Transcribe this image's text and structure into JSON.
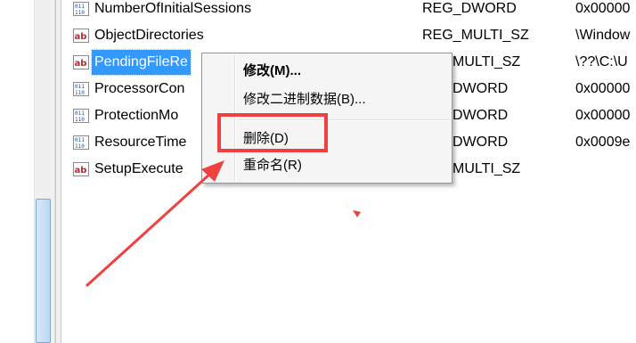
{
  "values": [
    {
      "name": "NumberOfInitialSessions",
      "type": "REG_DWORD",
      "data": "0x00000",
      "icon": "dword-icon"
    },
    {
      "name": "ObjectDirectories",
      "type": "REG_MULTI_SZ",
      "data": "\\Window",
      "icon": "string-icon"
    },
    {
      "name": "PendingFileRe",
      "type": "MULTI_SZ",
      "data": "\\??\\C:\\U",
      "icon": "string-icon",
      "selected": true
    },
    {
      "name": "ProcessorCon",
      "type": "DWORD",
      "data": "0x00000",
      "icon": "dword-icon"
    },
    {
      "name": "ProtectionMo",
      "type": "DWORD",
      "data": "0x00000",
      "icon": "dword-icon"
    },
    {
      "name": "ResourceTime",
      "type": "DWORD",
      "data": "0x0009e",
      "icon": "dword-icon"
    },
    {
      "name": "SetupExecute",
      "type": "MULTI_SZ",
      "data": "",
      "icon": "string-icon"
    }
  ],
  "context_menu": {
    "modify": "修改(M)...",
    "modify_binary": "修改二进制数据(B)...",
    "delete": "删除(D)",
    "rename": "重命名(R)"
  },
  "annotation_color": "#f04040",
  "selection_color": "#3399ff"
}
